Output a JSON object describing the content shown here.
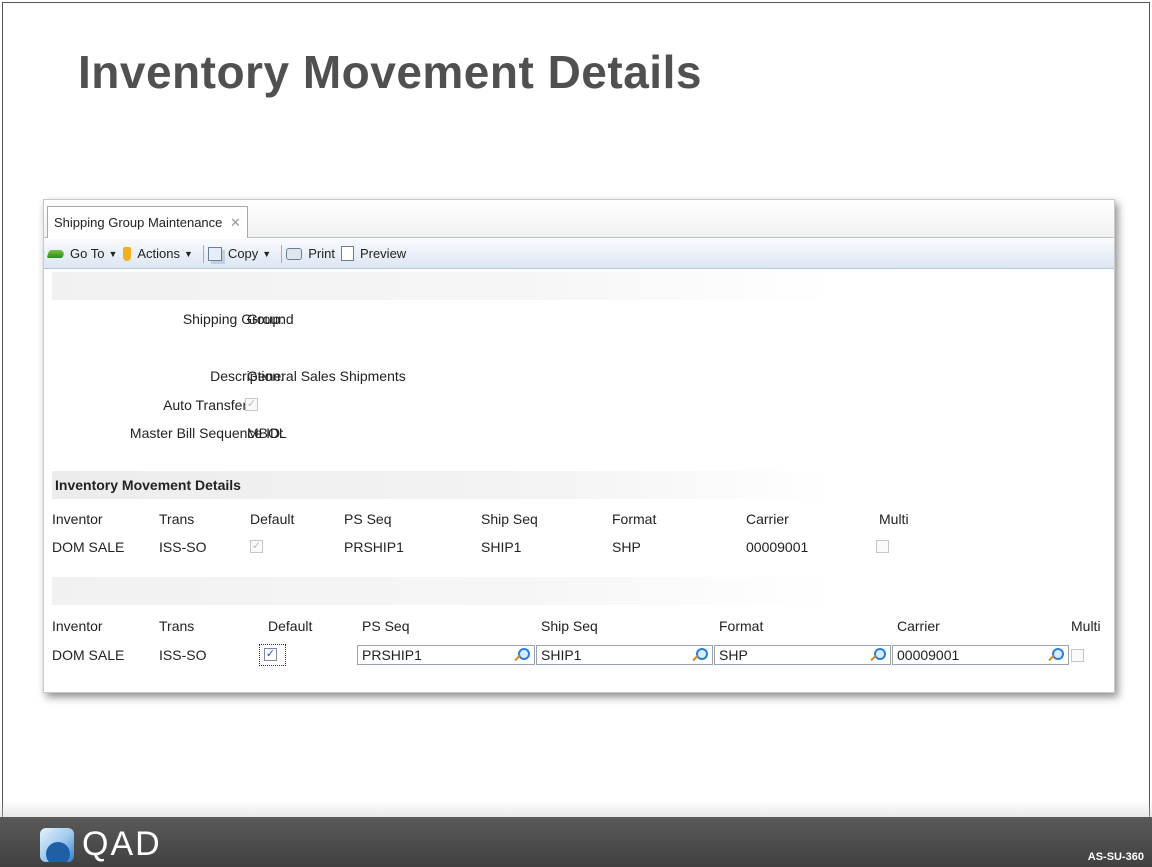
{
  "slide": {
    "title": "Inventory Movement Details",
    "code": "AS-SU-360",
    "logo_text": "QAD"
  },
  "tab": {
    "label": "Shipping Group Maintenance",
    "close": "✕"
  },
  "toolbar": {
    "goto": "Go To",
    "actions": "Actions",
    "copy": "Copy",
    "print": "Print",
    "preview": "Preview"
  },
  "form": {
    "shipping_group_label": "Shipping Group:",
    "shipping_group_value": "Ground",
    "description_label": "Description:",
    "description_value": "General Sales Shipments",
    "auto_transfers_label": "Auto Transfers:",
    "auto_transfers_checked": true,
    "master_bill_label": "Master Bill Sequence ID:",
    "master_bill_value": "MBOL"
  },
  "details": {
    "section_title": "Inventory Movement Details",
    "columns": [
      "Inventor",
      "Trans",
      "Default",
      "PS Seq",
      "Ship Seq",
      "Format",
      "Carrier",
      "Multi"
    ],
    "row": {
      "inventory": "DOM SALE",
      "trans": "ISS-SO",
      "default": true,
      "ps_seq": "PRSHIP1",
      "ship_seq": "SHIP1",
      "format": "SHP",
      "carrier": "00009001",
      "multi": false
    }
  },
  "edit_row": {
    "columns": [
      "Inventor",
      "Trans",
      "Default",
      "PS Seq",
      "Ship Seq",
      "Format",
      "Carrier",
      "Multi"
    ],
    "inventory": "DOM SALE",
    "trans": "ISS-SO",
    "default": true,
    "ps_seq": "PRSHIP1",
    "ship_seq": "SHIP1",
    "format": "SHP",
    "carrier": "00009001",
    "multi": false
  },
  "icons": [
    "goto-icon",
    "actions-icon",
    "copy-icon",
    "print-icon",
    "preview-icon",
    "lookup-icon",
    "close-icon"
  ],
  "colors": {
    "title": "#505050",
    "toolbar_top": "#f8fafd",
    "toolbar_bottom": "#dde6f3",
    "footer": "#4a4a4a",
    "lookup": "#2b7fd6"
  }
}
